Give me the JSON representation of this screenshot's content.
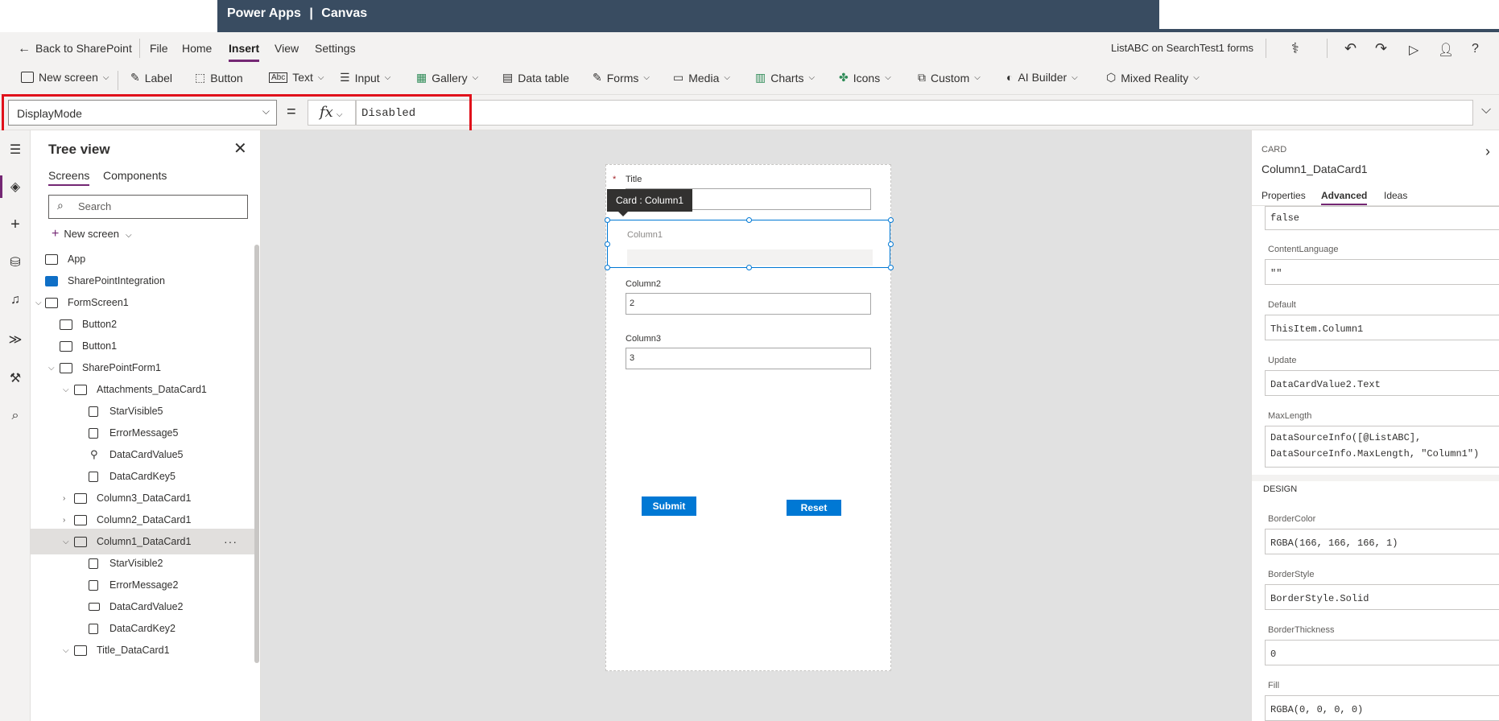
{
  "titlebar": {
    "app": "Power Apps",
    "sep": "|",
    "mode": "Canvas"
  },
  "menu": {
    "back": "Back to SharePoint",
    "items": [
      "File",
      "Home",
      "Insert",
      "View",
      "Settings"
    ],
    "active": "Insert",
    "app_name": "ListABC on SearchTest1 forms"
  },
  "ribbon": {
    "items": [
      "New screen",
      "Label",
      "Button",
      "Text",
      "Input",
      "Gallery",
      "Data table",
      "Forms",
      "Media",
      "Charts",
      "Icons",
      "Custom",
      "AI Builder",
      "Mixed Reality"
    ]
  },
  "formula": {
    "property": "DisplayMode",
    "equals": "=",
    "fx": "fx",
    "value": "Disabled"
  },
  "tree": {
    "title": "Tree view",
    "tabs": [
      "Screens",
      "Components"
    ],
    "search_placeholder": "Search",
    "new_screen": "New screen",
    "rows": [
      {
        "label": "App"
      },
      {
        "label": "SharePointIntegration"
      },
      {
        "label": "FormScreen1"
      },
      {
        "label": "Button2"
      },
      {
        "label": "Button1"
      },
      {
        "label": "SharePointForm1"
      },
      {
        "label": "Attachments_DataCard1"
      },
      {
        "label": "StarVisible5"
      },
      {
        "label": "ErrorMessage5"
      },
      {
        "label": "DataCardValue5"
      },
      {
        "label": "DataCardKey5"
      },
      {
        "label": "Column3_DataCard1"
      },
      {
        "label": "Column2_DataCard1"
      },
      {
        "label": "Column1_DataCard1"
      },
      {
        "label": "StarVisible2"
      },
      {
        "label": "ErrorMessage2"
      },
      {
        "label": "DataCardValue2"
      },
      {
        "label": "DataCardKey2"
      },
      {
        "label": "Title_DataCard1"
      }
    ],
    "more": "···"
  },
  "canvas": {
    "form": {
      "title_star": "*",
      "title_label": "Title",
      "tooltip": "Card : Column1",
      "column1_label": "Column1",
      "column2_label": "Column2",
      "column2_value": "2",
      "column3_label": "Column3",
      "column3_value": "3",
      "submit": "Submit",
      "reset": "Reset"
    }
  },
  "props": {
    "section": "CARD",
    "name": "Column1_DataCard1",
    "tabs": [
      "Properties",
      "Advanced",
      "Ideas"
    ],
    "active_tab": "Advanced",
    "top_value": "false",
    "fields": [
      {
        "label": "ContentLanguage",
        "value": "\"\""
      },
      {
        "label": "Default",
        "value": "ThisItem.Column1"
      },
      {
        "label": "Update",
        "value": "DataCardValue2.Text"
      },
      {
        "label": "MaxLength",
        "value": "DataSourceInfo([@ListABC],",
        "value2": "DataSourceInfo.MaxLength, \"Column1\")"
      }
    ],
    "design_title": "DESIGN",
    "design_fields": [
      {
        "label": "BorderColor",
        "value": "RGBA(166, 166, 166, 1)"
      },
      {
        "label": "BorderStyle",
        "value": "BorderStyle.Solid"
      },
      {
        "label": "BorderThickness",
        "value": "0"
      },
      {
        "label": "Fill",
        "value": "RGBA(0, 0, 0, 0)"
      }
    ]
  },
  "colors": {
    "accent": "#742774",
    "titlebar": "#394c61",
    "highlight": "#e0111b",
    "button": "#0078d4"
  }
}
